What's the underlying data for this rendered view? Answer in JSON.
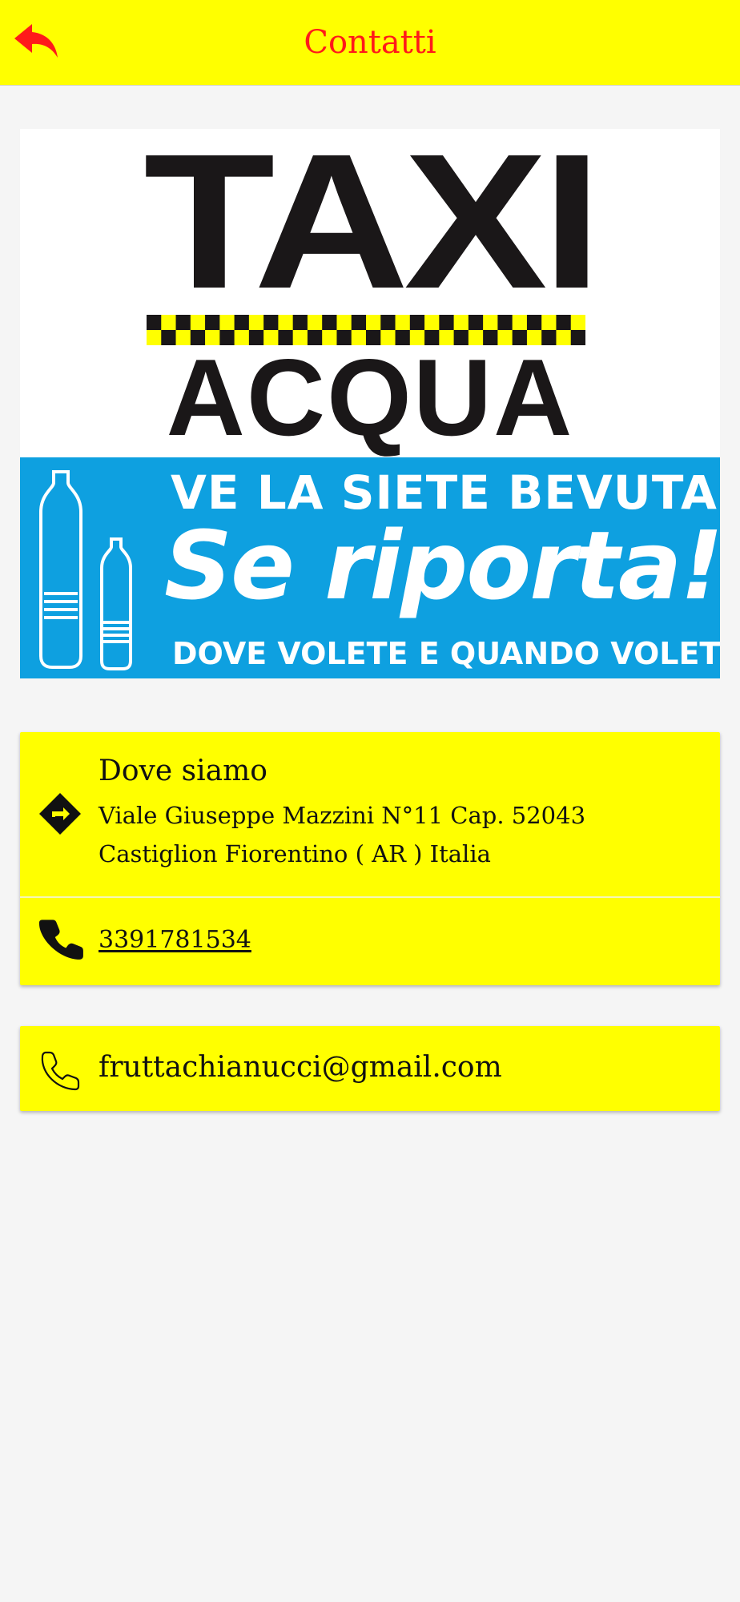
{
  "header": {
    "title": "Contatti",
    "back_icon": "reply-arrow-icon",
    "background_color": "#ffff00",
    "title_color": "#ff1a1a"
  },
  "banner": {
    "line1": "TAXI",
    "line2": "ACQUA",
    "tagline_top": "VE LA SIETE BEVUTA?",
    "tagline_main": "Se riporta!",
    "tagline_bottom": "DOVE VOLETE E QUANDO VOLETE",
    "accent_color": "#0ea0e0"
  },
  "contact": {
    "address_title": "Dove siamo",
    "address": "Viale Giuseppe Mazzini N°11 Cap. 52043 Castiglion Fiorentino ( AR ) Italia",
    "address_icon": "directions-icon",
    "phone": "3391781534",
    "phone_icon": "phone-icon"
  },
  "email": {
    "value": "fruttachianucci@gmail.com",
    "icon": "phone-outline-icon"
  },
  "colors": {
    "card_background": "#ffff00",
    "page_background": "#f5f5f5"
  }
}
